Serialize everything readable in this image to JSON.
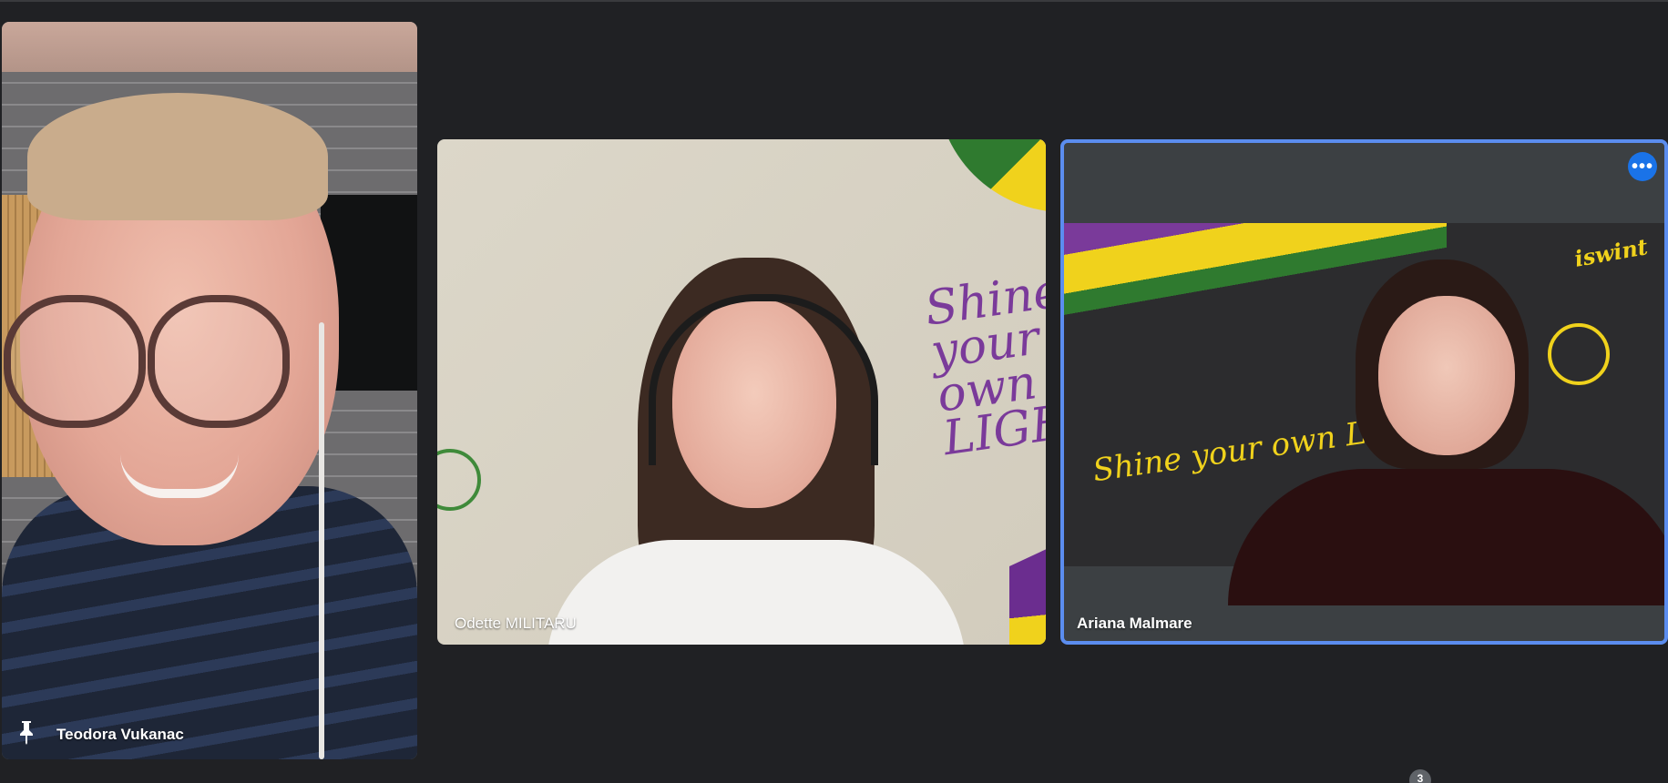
{
  "participants": [
    {
      "name": "Teodora Vukanac",
      "pinned": true,
      "icon": "pin-icon"
    },
    {
      "name": "Odette MILITARU",
      "background_text": "Shine your own LIGHT"
    },
    {
      "name": "Ariana Malmare",
      "active_speaker": true,
      "background_text": "Shine your own LIGHT",
      "logo_text": "iswint",
      "menu_icon": "more-options-icon"
    }
  ],
  "participant_count": "3",
  "colors": {
    "background": "#202124",
    "tile": "#3c4043",
    "active_border": "#5b8def",
    "accent_button": "#1a73e8"
  }
}
